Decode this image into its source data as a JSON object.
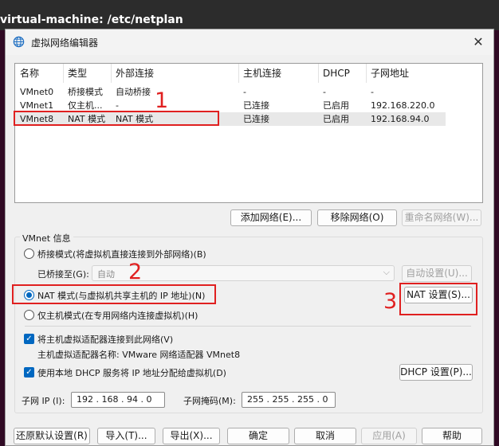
{
  "terminal": {
    "title": "virtual-machine: /etc/netplan"
  },
  "dialog": {
    "title": "虚拟网络编辑器",
    "close": "✕"
  },
  "table": {
    "headers": [
      "名称",
      "类型",
      "外部连接",
      "主机连接",
      "DHCP",
      "子网地址"
    ],
    "rows": [
      [
        "VMnet0",
        "桥接模式",
        "自动桥接",
        "-",
        "-",
        "-"
      ],
      [
        "VMnet1",
        "仅主机...",
        "-",
        "已连接",
        "已启用",
        "192.168.220.0"
      ],
      [
        "VMnet8",
        "NAT 模式",
        "NAT 模式",
        "已连接",
        "已启用",
        "192.168.94.0"
      ]
    ]
  },
  "buttons": {
    "add_network": "添加网络(E)...",
    "remove_network": "移除网络(O)",
    "rename_network": "重命名网络(W)...",
    "auto_settings": "自动设置(U)...",
    "nat_settings": "NAT 设置(S)...",
    "dhcp_settings": "DHCP 设置(P)...",
    "restore_defaults": "还原默认设置(R)",
    "import": "导入(T)...",
    "export": "导出(X)...",
    "ok": "确定",
    "cancel": "取消",
    "apply": "应用(A)",
    "help": "帮助"
  },
  "vmnet_info": {
    "group_label": "VMnet 信息",
    "bridged_label": "桥接模式(将虚拟机直接连接到外部网络)(B)",
    "bridged_to_label": "已桥接至(G):",
    "bridged_to_value": "自动",
    "nat_label": "NAT 模式(与虚拟机共享主机的 IP 地址)(N)",
    "hostonly_label": "仅主机模式(在专用网络内连接虚拟机)(H)",
    "connect_adapter_label": "将主机虚拟适配器连接到此网络(V)",
    "adapter_name_label": "主机虚拟适配器名称: VMware 网络适配器 VMnet8",
    "dhcp_label": "使用本地 DHCP 服务将 IP 地址分配给虚拟机(D)",
    "subnet_ip_label": "子网 IP (I):",
    "subnet_ip_value": "192 . 168 . 94 . 0",
    "subnet_mask_label": "子网掩码(M):",
    "subnet_mask_value": "255 . 255 . 255 . 0",
    "selected_mode": "nat"
  },
  "annotations": {
    "one": "1",
    "two": "2",
    "three": "3"
  },
  "colors": {
    "accent": "#0067c0",
    "annotation": "#e02020",
    "terminal_bg": "#300a24"
  }
}
